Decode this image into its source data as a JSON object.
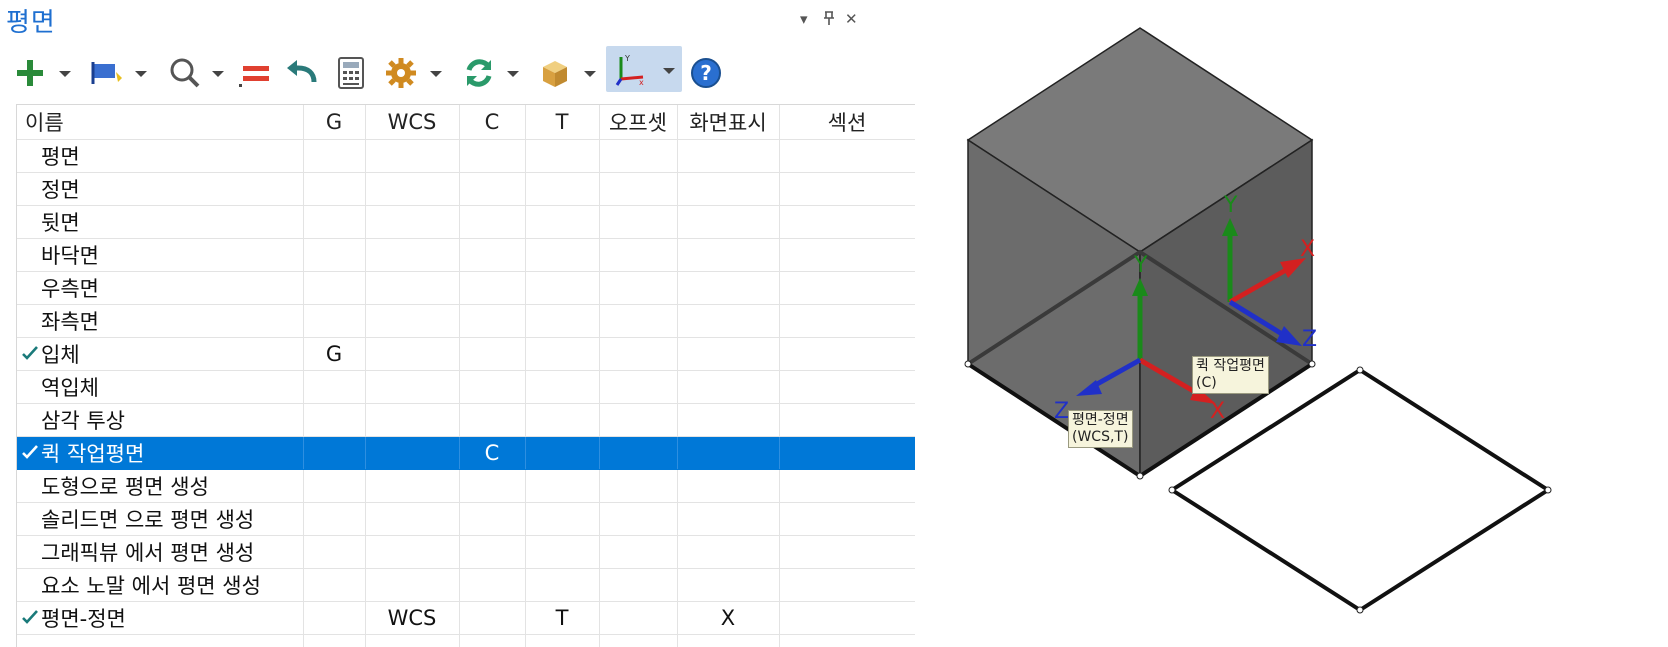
{
  "panel": {
    "title": "평면",
    "controls": {
      "menu": "▾",
      "pin": "ᵖ",
      "close": "✕"
    }
  },
  "toolbar": {
    "items": [
      {
        "name": "add",
        "icon": "plus-icon"
      },
      {
        "name": "flag",
        "icon": "flag-icon"
      },
      {
        "name": "search",
        "icon": "search-icon"
      },
      {
        "name": "equals",
        "icon": "equals-icon"
      },
      {
        "name": "undo",
        "icon": "undo-icon"
      },
      {
        "name": "calculator",
        "icon": "calculator-icon"
      },
      {
        "name": "settings",
        "icon": "gear-icon"
      },
      {
        "name": "refresh",
        "icon": "refresh-icon"
      },
      {
        "name": "box",
        "icon": "box-icon"
      },
      {
        "name": "axis",
        "icon": "axis-icon"
      },
      {
        "name": "help",
        "icon": "help-icon"
      }
    ]
  },
  "table": {
    "columns": [
      "이름",
      "G",
      "WCS",
      "C",
      "T",
      "오프셋",
      "화면표시",
      "섹션"
    ],
    "rows": [
      {
        "name": "평면",
        "g": "",
        "wcs": "",
        "c": "",
        "t": "",
        "offset": "",
        "display": "",
        "section": "",
        "checked": false,
        "selected": false
      },
      {
        "name": "정면",
        "g": "",
        "wcs": "",
        "c": "",
        "t": "",
        "offset": "",
        "display": "",
        "section": "",
        "checked": false,
        "selected": false
      },
      {
        "name": "뒷면",
        "g": "",
        "wcs": "",
        "c": "",
        "t": "",
        "offset": "",
        "display": "",
        "section": "",
        "checked": false,
        "selected": false
      },
      {
        "name": "바닥면",
        "g": "",
        "wcs": "",
        "c": "",
        "t": "",
        "offset": "",
        "display": "",
        "section": "",
        "checked": false,
        "selected": false
      },
      {
        "name": "우측면",
        "g": "",
        "wcs": "",
        "c": "",
        "t": "",
        "offset": "",
        "display": "",
        "section": "",
        "checked": false,
        "selected": false
      },
      {
        "name": "좌측면",
        "g": "",
        "wcs": "",
        "c": "",
        "t": "",
        "offset": "",
        "display": "",
        "section": "",
        "checked": false,
        "selected": false
      },
      {
        "name": "입체",
        "g": "G",
        "wcs": "",
        "c": "",
        "t": "",
        "offset": "",
        "display": "",
        "section": "",
        "checked": true,
        "selected": false
      },
      {
        "name": "역입체",
        "g": "",
        "wcs": "",
        "c": "",
        "t": "",
        "offset": "",
        "display": "",
        "section": "",
        "checked": false,
        "selected": false
      },
      {
        "name": "삼각 투상",
        "g": "",
        "wcs": "",
        "c": "",
        "t": "",
        "offset": "",
        "display": "",
        "section": "",
        "checked": false,
        "selected": false
      },
      {
        "name": "퀵 작업평면",
        "g": "",
        "wcs": "",
        "c": "C",
        "t": "",
        "offset": "",
        "display": "",
        "section": "",
        "checked": true,
        "selected": true
      },
      {
        "name": "도형으로 평면 생성",
        "g": "",
        "wcs": "",
        "c": "",
        "t": "",
        "offset": "",
        "display": "",
        "section": "",
        "checked": false,
        "selected": false
      },
      {
        "name": "솔리드면 으로 평면 생성",
        "g": "",
        "wcs": "",
        "c": "",
        "t": "",
        "offset": "",
        "display": "",
        "section": "",
        "checked": false,
        "selected": false
      },
      {
        "name": "그래픽뷰 에서 평면 생성",
        "g": "",
        "wcs": "",
        "c": "",
        "t": "",
        "offset": "",
        "display": "",
        "section": "",
        "checked": false,
        "selected": false
      },
      {
        "name": "요소 노말 에서 평면 생성",
        "g": "",
        "wcs": "",
        "c": "",
        "t": "",
        "offset": "",
        "display": "",
        "section": "",
        "checked": false,
        "selected": false
      },
      {
        "name": "평면-정면",
        "g": "",
        "wcs": "WCS",
        "c": "",
        "t": "T",
        "offset": "",
        "display": "X",
        "section": "",
        "checked": true,
        "selected": false
      }
    ]
  },
  "viewport": {
    "axis_labels": {
      "x": "X",
      "y": "Y",
      "z": "Z"
    },
    "tooltip_quick": {
      "line1": "퀵 작업평면",
      "line2": "(C)"
    },
    "tooltip_front": {
      "line1": "평면-정면",
      "line2": "(WCS,T)"
    },
    "colors": {
      "x_axis": "#d42020",
      "y_axis": "#1a8a1a",
      "z_axis": "#2030c8",
      "selection": "#0078d7",
      "accent": "#1e6fd0"
    }
  }
}
